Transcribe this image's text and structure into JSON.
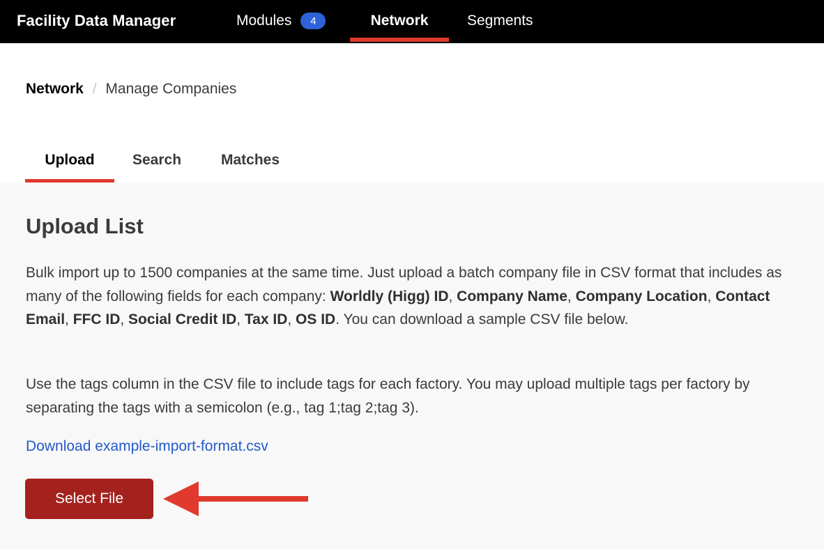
{
  "app": {
    "title": "Facility Data Manager"
  },
  "nav": {
    "modules_label": "Modules",
    "modules_count": "4",
    "network_label": "Network",
    "segments_label": "Segments"
  },
  "breadcrumb": {
    "root": "Network",
    "separator": "/",
    "current": "Manage Companies"
  },
  "tabs": {
    "upload": "Upload",
    "search": "Search",
    "matches": "Matches"
  },
  "upload": {
    "title": "Upload List",
    "intro_1": "Bulk import up to 1500 companies at the same time. Just upload a batch company file in CSV format that includes as many of the following fields for each company: ",
    "fields": [
      "Worldly (Higg) ID",
      "Company Name",
      "Company Location",
      "Contact Email",
      "FFC ID",
      "Social Credit ID",
      "Tax ID",
      "OS ID"
    ],
    "field_separator": ", ",
    "intro_2": ". You can download a sample CSV file below.",
    "tags_text": "Use the tags column in the CSV file to include tags for each factory. You may upload multiple tags per factory by separating the tags with a semicolon (e.g., tag 1;tag 2;tag 3).",
    "download_link": "Download example-import-format.csv",
    "select_button": "Select File"
  },
  "colors": {
    "topbar": "#000000",
    "accent_red": "#e03a2e",
    "badge_blue": "#2d62d8",
    "link_blue": "#2559c9",
    "button_red": "#a3221e",
    "content_bg": "#f8f8f8"
  },
  "icons": {
    "annotation_arrow": "left-arrow-icon"
  }
}
